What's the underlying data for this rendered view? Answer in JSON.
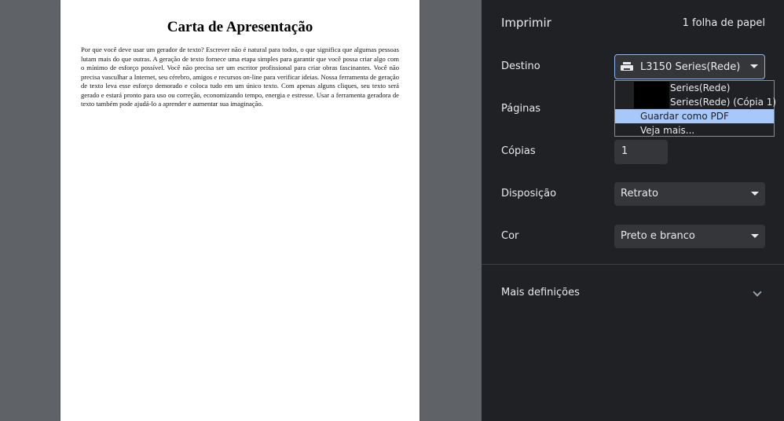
{
  "document": {
    "title": "Carta de Apresentação",
    "body": "Por que você deve usar um gerador de texto? Escrever não é natural para todos, o que significa que algumas pessoas lutam mais do que outras. A geração de texto fornece uma etapa simples para garantir que você possa criar algo com o mínimo de esforço possível. Você não precisa ser um escritor profissional para criar obras fascinantes. Você não precisa vasculhar a Internet, seu cérebro, amigos e recursos on-line para verificar ideias. Nossa ferramenta de geração de texto leva esse esforço demorado e coloca tudo em um único texto. Com apenas alguns cliques, seu texto será gerado e estará pronto para uso ou correção, economizando tempo, energia e estresse. Usar a ferramenta geradora de texto também pode ajudá-lo a aprender e aumentar sua imaginação."
  },
  "print_panel": {
    "title": "Imprimir",
    "sheet_count": "1 folha de papel",
    "destination": {
      "label": "Destino",
      "value": "L3150 Series(Rede)",
      "icon": "printer-icon",
      "options": [
        "Series(Rede)",
        "Series(Rede) (Cópia 1)",
        "Guardar como PDF",
        "Veja mais..."
      ],
      "highlighted_option": "Guardar como PDF"
    },
    "pages": {
      "label": "Páginas"
    },
    "copies": {
      "label": "Cópias",
      "value": "1"
    },
    "layout": {
      "label": "Disposição",
      "value": "Retrato"
    },
    "color": {
      "label": "Cor",
      "value": "Preto e branco"
    },
    "more_settings": {
      "label": "Mais definições"
    }
  },
  "colors": {
    "panel_bg": "#202124",
    "control_bg": "#35363a",
    "highlight": "#a8c7fa",
    "focus_border": "#8ab4f8",
    "preview_bg": "#5f6368"
  }
}
